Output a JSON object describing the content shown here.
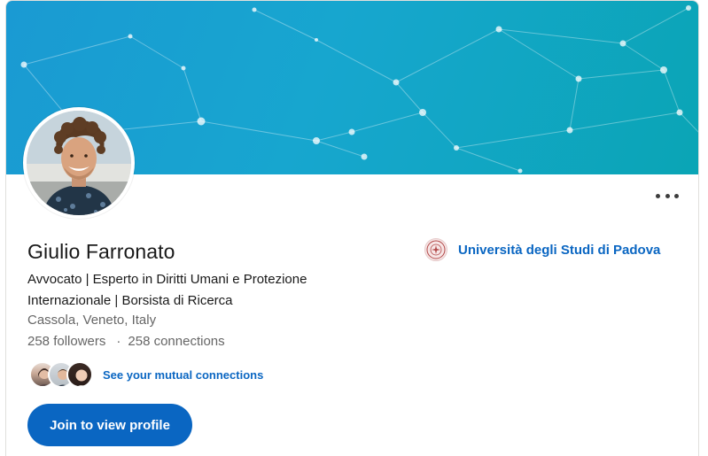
{
  "profile": {
    "name": "Giulio Farronato",
    "headline": "Avvocato | Esperto in Diritti Umani e Protezione Internazionale | Borsista di Ricerca",
    "location": "Cassola, Veneto, Italy",
    "followers": "258 followers",
    "connections_separator": "·",
    "connections": "258 connections"
  },
  "mutual": {
    "link_label": "See your mutual connections"
  },
  "actions": {
    "join_label": "Join to view profile"
  },
  "education": {
    "name": "Università degli Studi di Padova"
  },
  "icons": {
    "more": "more-options-icon",
    "university_logo": "university-seal-icon"
  },
  "colors": {
    "accent": "#0a66c2",
    "banner_start": "#1a9ad3",
    "banner_end": "#0aa5b5"
  }
}
